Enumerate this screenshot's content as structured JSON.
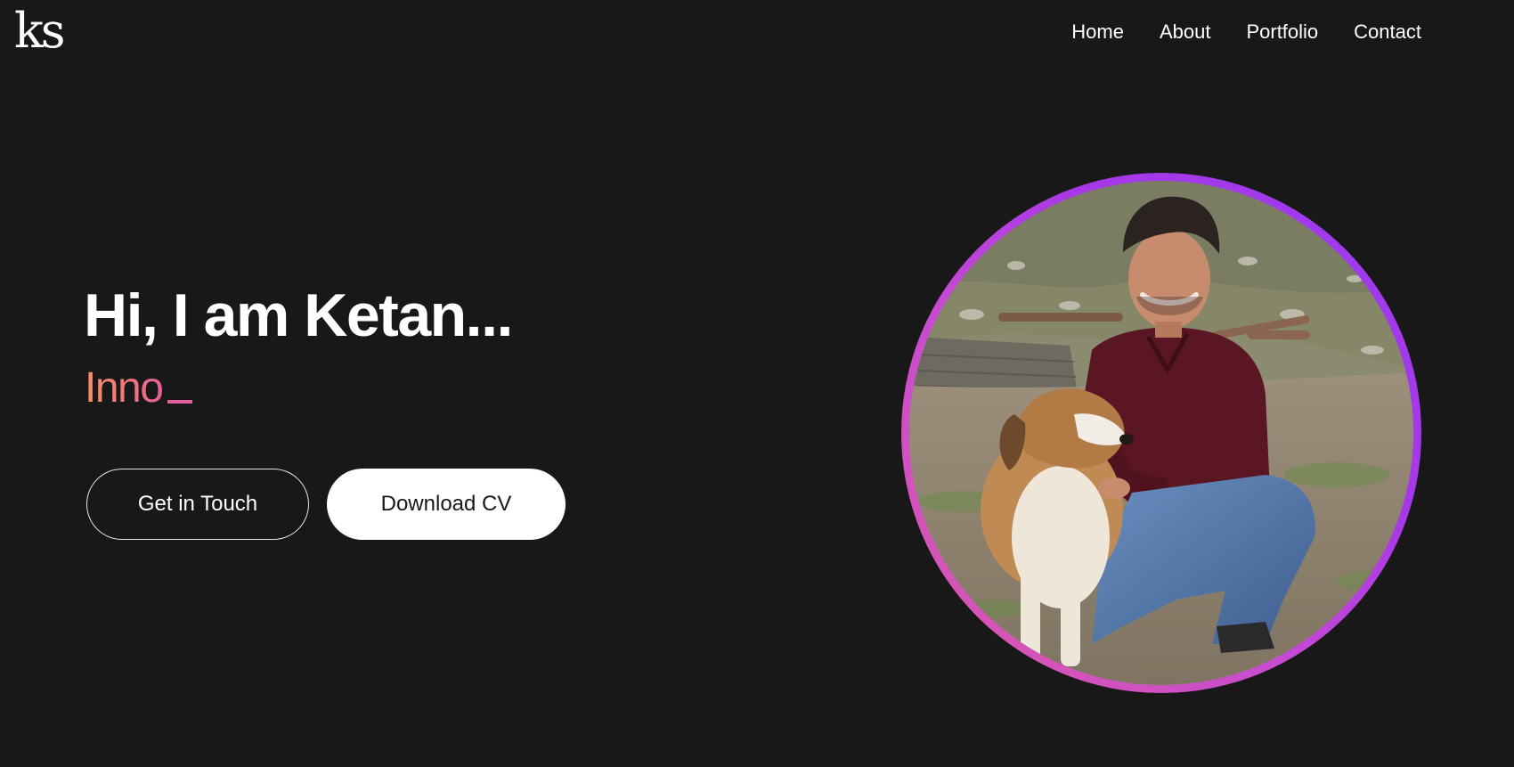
{
  "header": {
    "logo_text": "ks",
    "nav": [
      {
        "label": "Home"
      },
      {
        "label": "About"
      },
      {
        "label": "Portfolio"
      },
      {
        "label": "Contact"
      }
    ]
  },
  "hero": {
    "greeting": "Hi, I am Ketan...",
    "typed_text": "Inno",
    "buttons": {
      "contact_label": "Get in Touch",
      "cv_label": "Download CV"
    }
  },
  "portrait": {
    "subject": "photo of person kneeling beside a dog outdoors"
  },
  "colors": {
    "background": "#181818",
    "accent_orange": "#f7906a",
    "accent_pink": "#e25ca0",
    "accent_purple": "#9b3cf0",
    "text": "#ffffff"
  }
}
